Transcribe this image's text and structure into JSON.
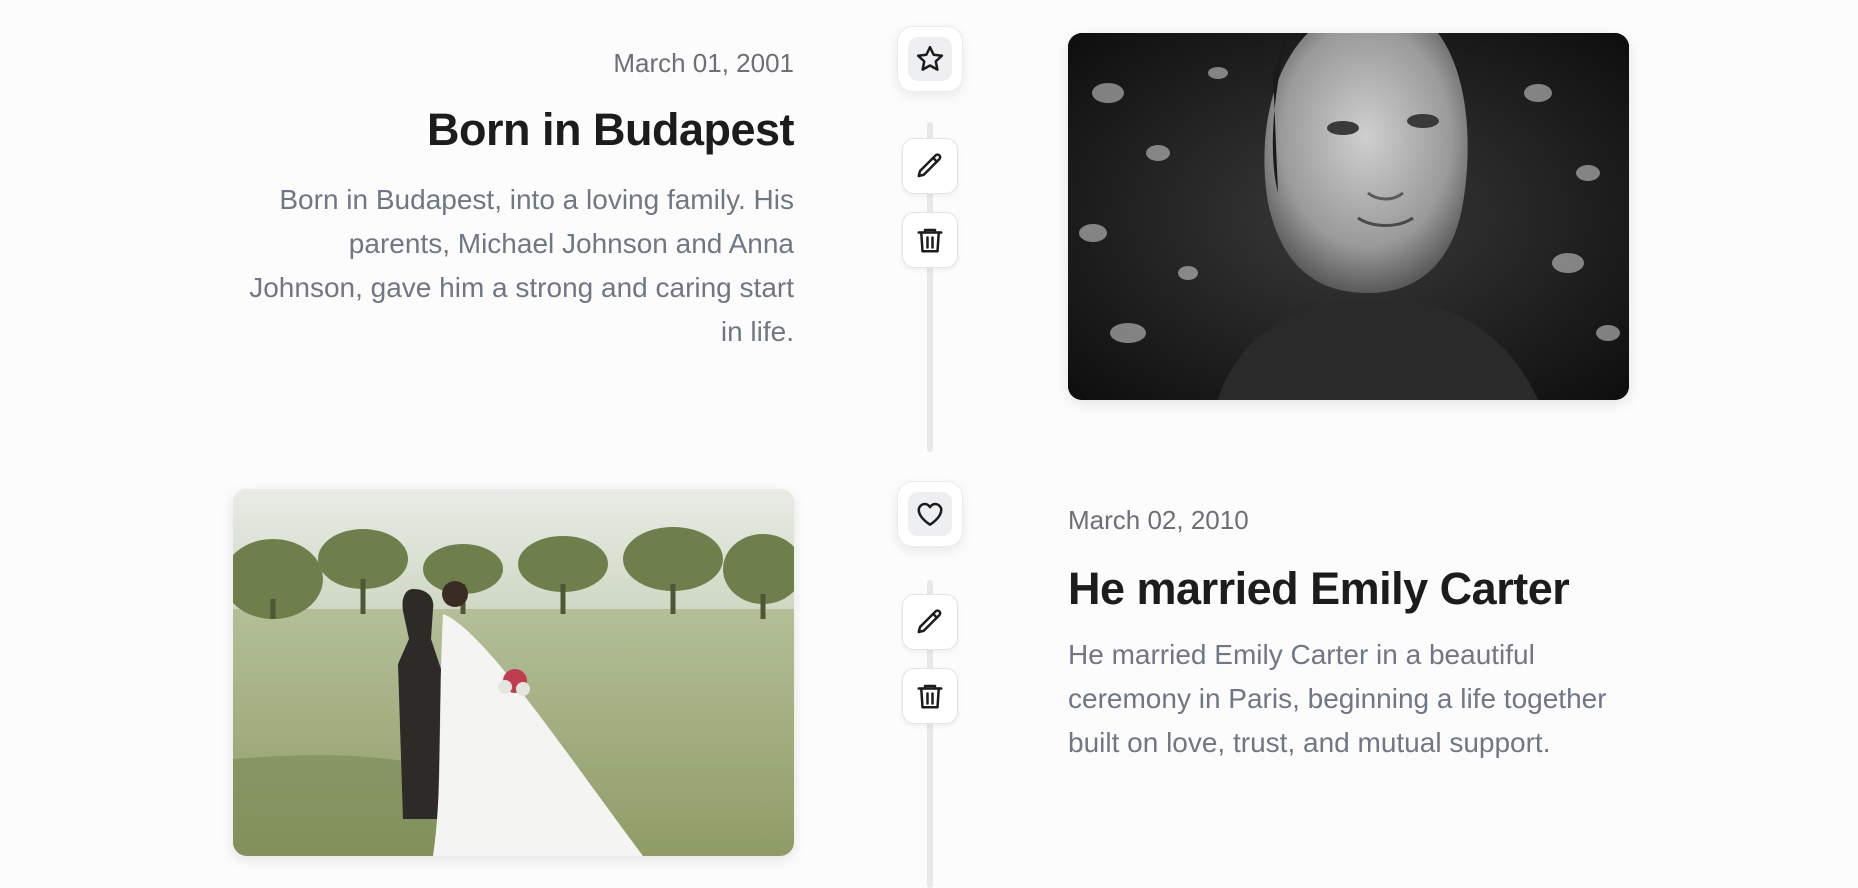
{
  "timeline": {
    "events": [
      {
        "date": "March 01, 2001",
        "title": "Born in Budapest",
        "description": "Born in Budapest, into a loving family. His parents, Michael Johnson and Anna Johnson, gave him a strong and caring start in life.",
        "marker_icon": "star-icon",
        "photo": "portrait-photo"
      },
      {
        "date": "March 02, 2010",
        "title": "He married Emily Carter",
        "description": "He married Emily Carter in a beautiful ceremony in Paris, beginning a life together built on love, trust, and mutual support.",
        "marker_icon": "heart-icon",
        "photo": "wedding-photo"
      }
    ]
  },
  "colors": {
    "title": "#1c1c1c",
    "description": "#707784",
    "date": "#6d6f74",
    "timeline_line": "#e8e8e8"
  }
}
